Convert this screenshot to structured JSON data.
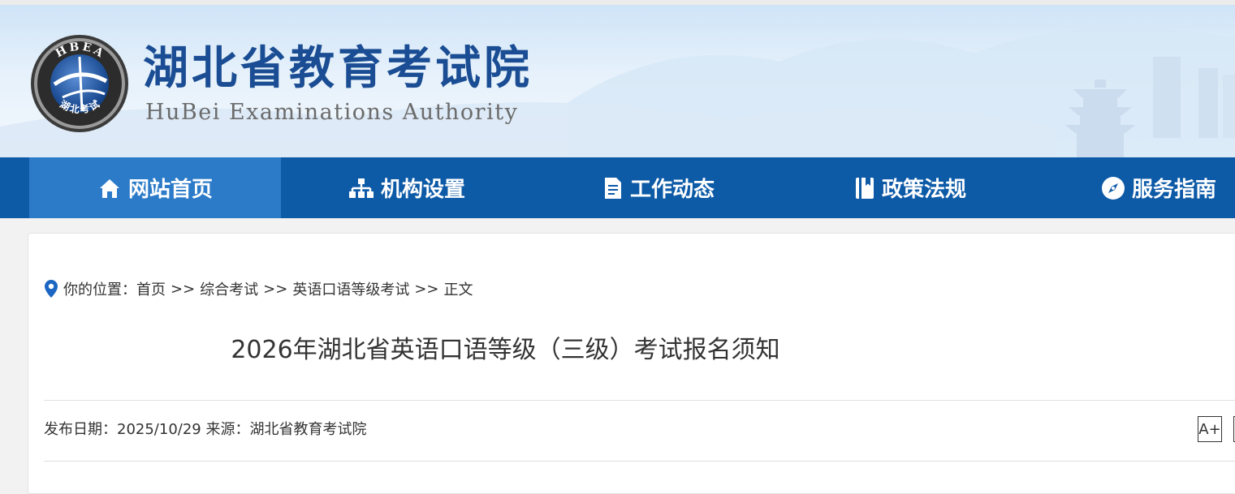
{
  "header": {
    "logo_text_top": "HBEA",
    "logo_text_bottom": "湖北考试",
    "title": "湖北省教育考试院",
    "subtitle": "HuBei Examinations Authority"
  },
  "nav": {
    "items": [
      {
        "label": "网站首页",
        "icon": "home-icon",
        "active": true
      },
      {
        "label": "机构设置",
        "icon": "org-chart-icon",
        "active": false
      },
      {
        "label": "工作动态",
        "icon": "document-icon",
        "active": false
      },
      {
        "label": "政策法规",
        "icon": "book-icon",
        "active": false
      },
      {
        "label": "服务指南",
        "icon": "compass-icon",
        "active": false
      }
    ]
  },
  "breadcrumb": {
    "prefix": "你的位置：",
    "items": [
      "首页",
      "综合考试",
      "英语口语等级考试",
      "正文"
    ],
    "separator": ">>"
  },
  "article": {
    "title": "2026年湖北省英语口语等级（三级）考试报名须知",
    "date_label": "发布日期：",
    "date": "2025/10/29",
    "source_label": "来源：",
    "source": "湖北省教育考试院"
  },
  "controls": {
    "font_increase": "A+"
  },
  "colors": {
    "nav_bg": "#0d5aa7",
    "nav_active": "#2c7bc9",
    "title_blue": "#1a4d93",
    "pin_blue": "#1a66c2"
  }
}
